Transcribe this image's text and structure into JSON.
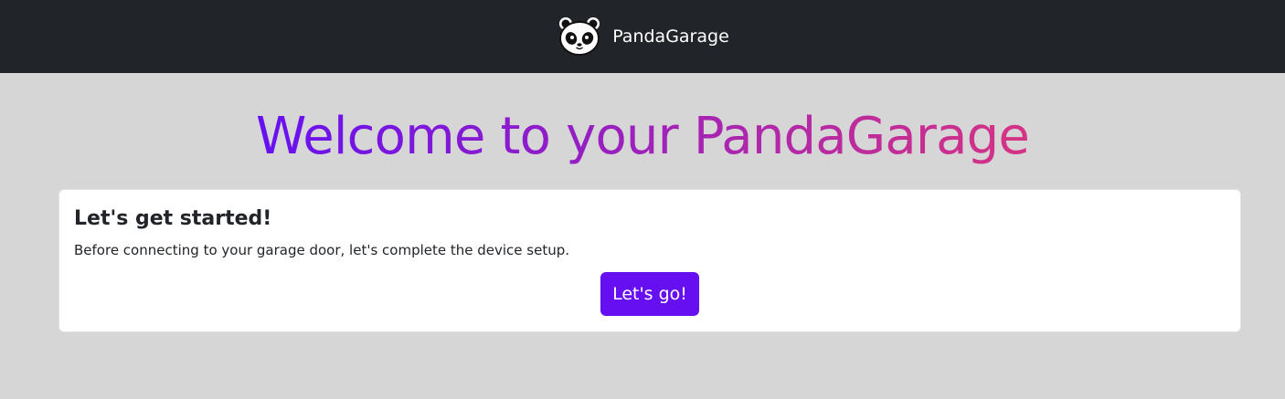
{
  "navbar": {
    "brand_name": "PandaGarage",
    "logo_icon": "panda-icon",
    "background_color": "#212529"
  },
  "welcome": {
    "heading": "Welcome to your PandaGarage",
    "gradient_start": "#6610f2",
    "gradient_end": "#d63384"
  },
  "card": {
    "title": "Let's get started!",
    "text": "Before connecting to your garage door, let's complete the device setup.",
    "button_label": "Let's go!",
    "button_color": "#6610f2"
  }
}
